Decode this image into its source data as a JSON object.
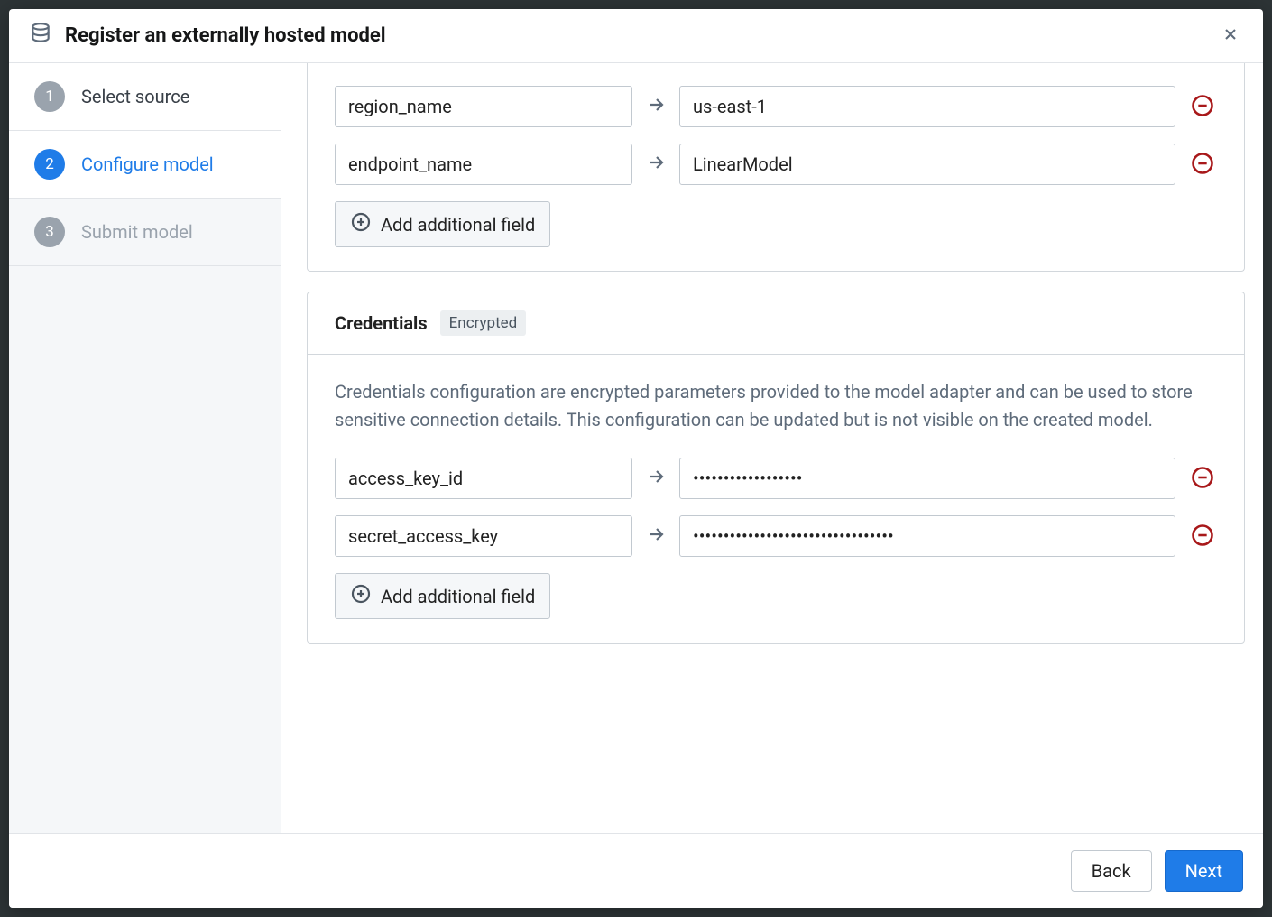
{
  "header": {
    "title": "Register an externally hosted model"
  },
  "steps": {
    "s1": {
      "num": "1",
      "label": "Select source"
    },
    "s2": {
      "num": "2",
      "label": "Configure model"
    },
    "s3": {
      "num": "3",
      "label": "Submit model"
    }
  },
  "config": {
    "rows": [
      {
        "key": "region_name",
        "value": "us-east-1"
      },
      {
        "key": "endpoint_name",
        "value": "LinearModel"
      }
    ],
    "add_label": "Add additional field"
  },
  "credentials": {
    "title": "Credentials",
    "tag": "Encrypted",
    "description": "Credentials configuration are encrypted parameters provided to the model adapter and can be used to store sensitive connection details. This configuration can be updated but is not visible on the created model.",
    "rows": [
      {
        "key": "access_key_id",
        "value": "••••••••••••••••••"
      },
      {
        "key": "secret_access_key",
        "value": "•••••••••••••••••••••••••••••••••"
      }
    ],
    "add_label": "Add additional field"
  },
  "footer": {
    "back": "Back",
    "next": "Next"
  }
}
